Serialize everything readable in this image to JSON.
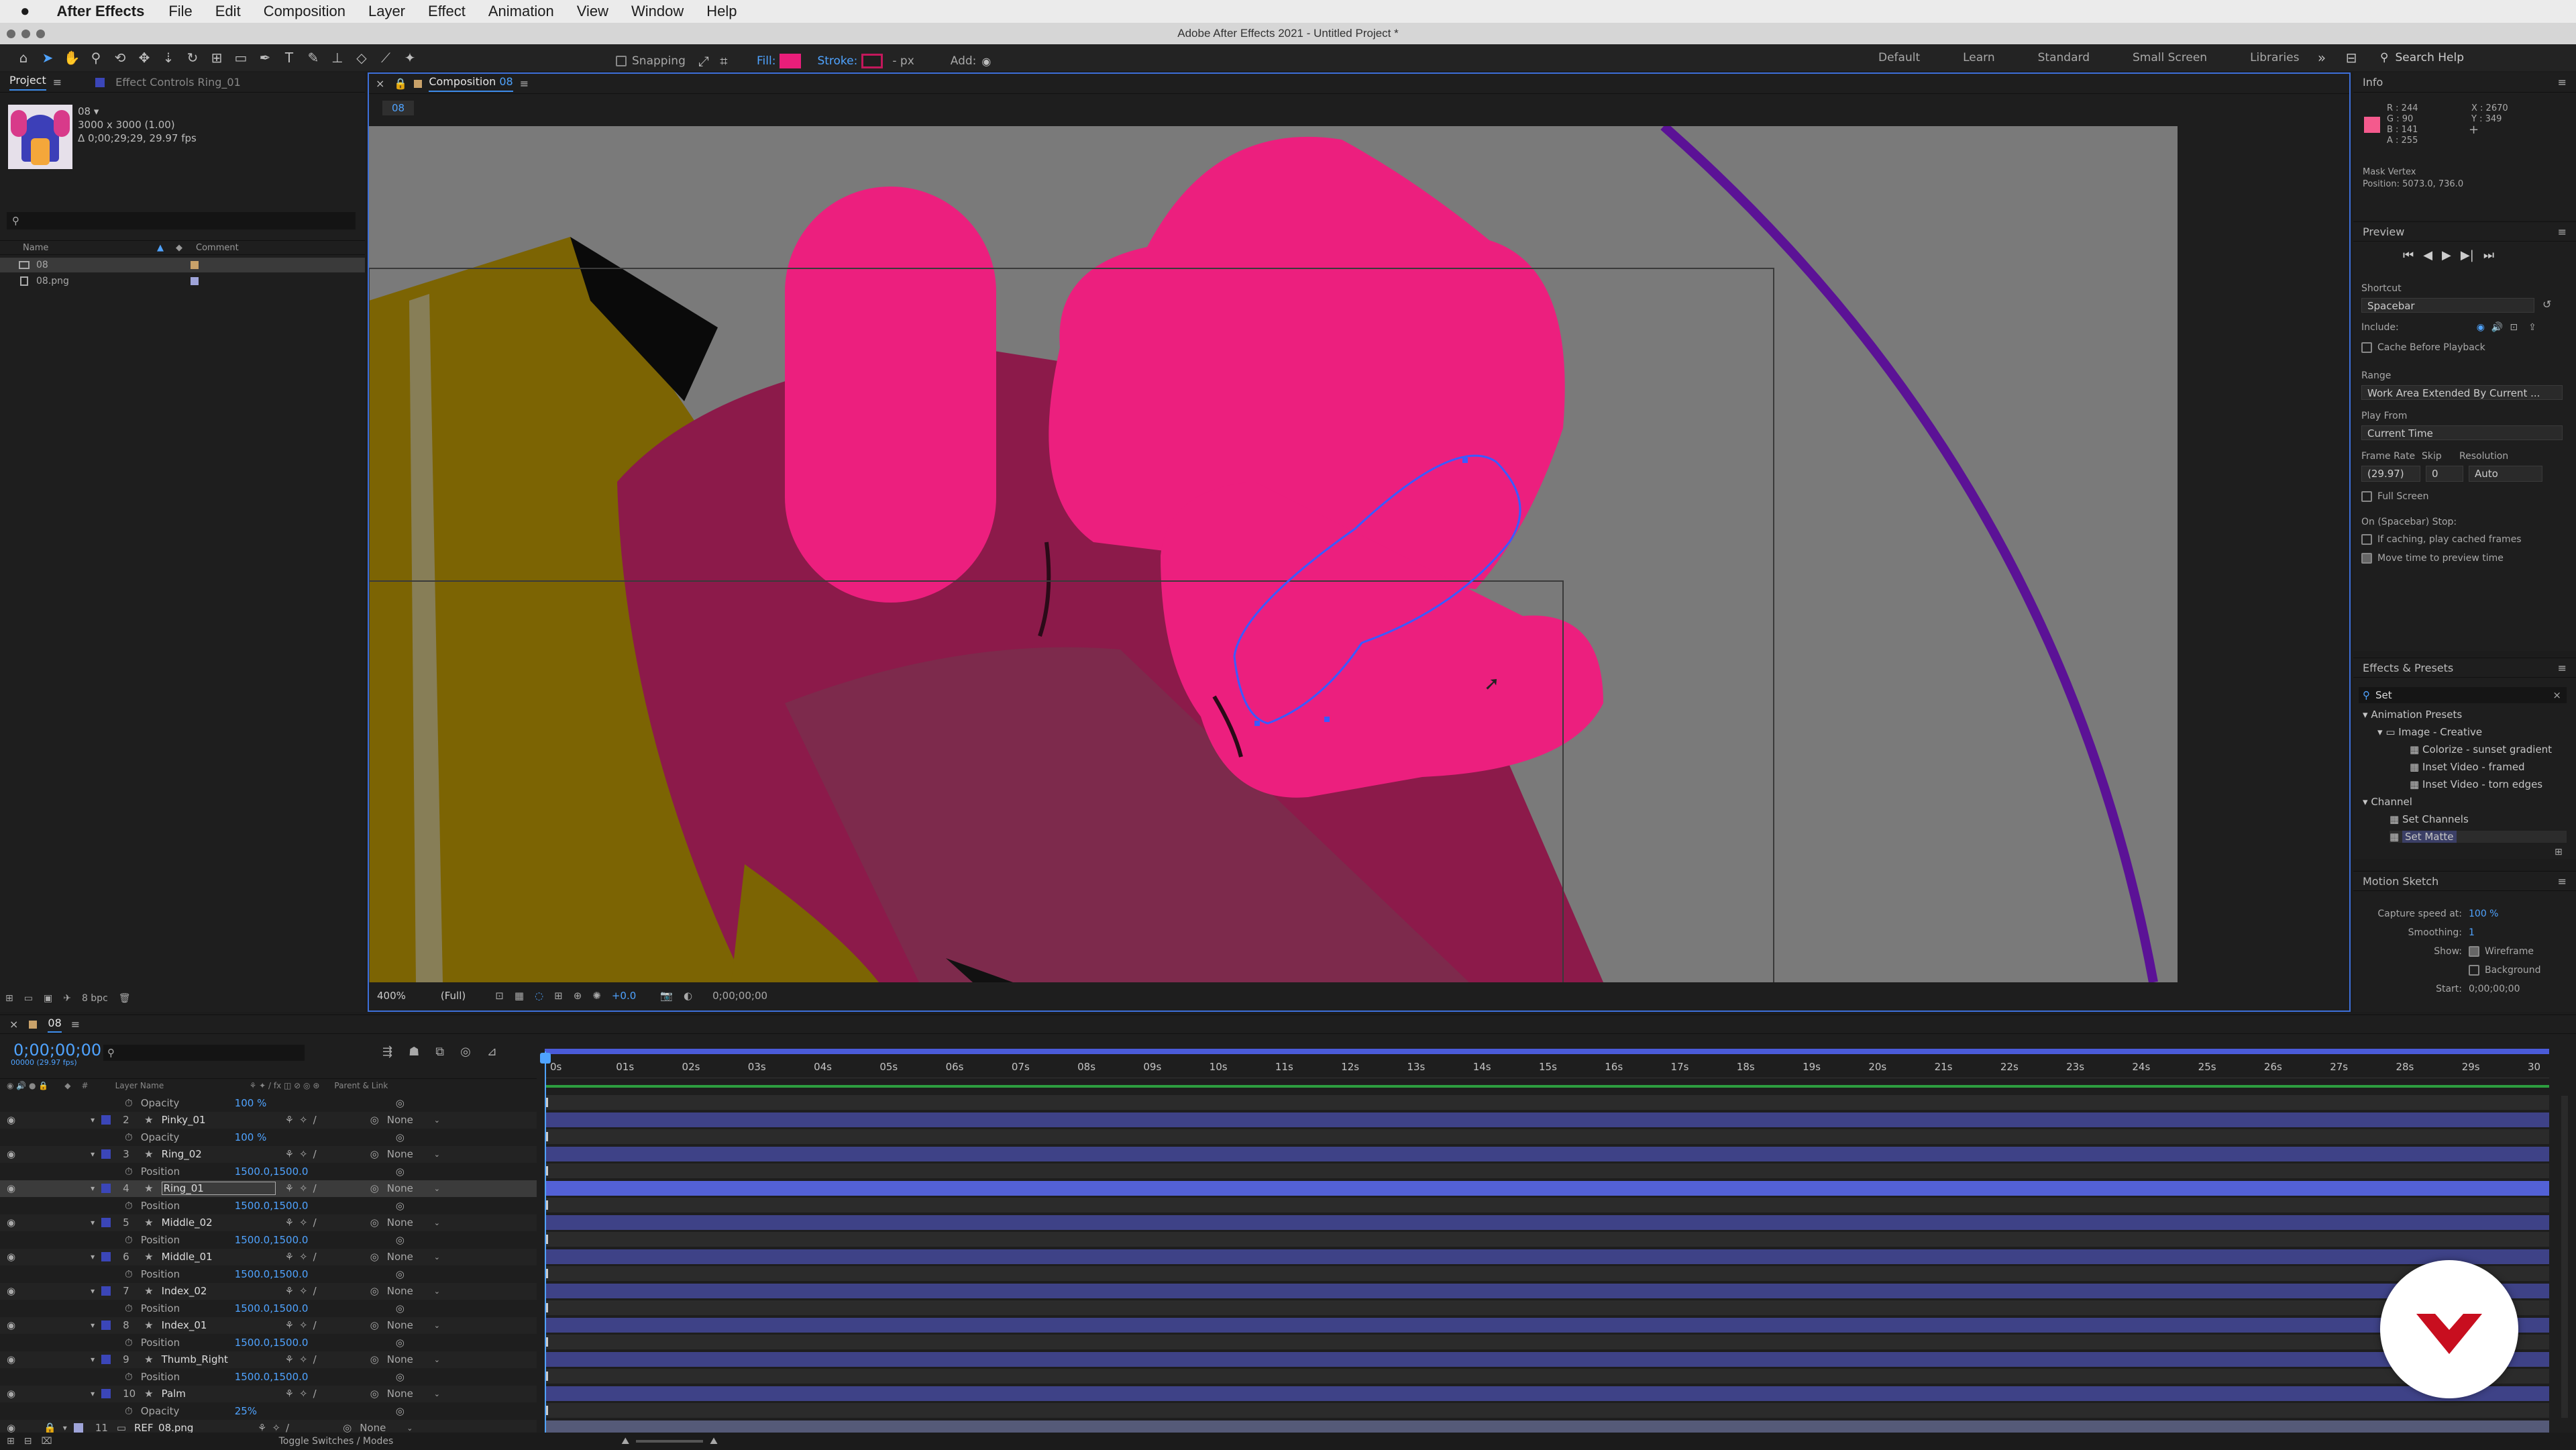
{
  "menubar": {
    "app": "After Effects",
    "items": [
      "File",
      "Edit",
      "Composition",
      "Layer",
      "Effect",
      "Animation",
      "View",
      "Window",
      "Help"
    ]
  },
  "window_title": "Adobe After Effects 2021 - Untitled Project *",
  "toolbar": {
    "snapping": "Snapping",
    "fill": "Fill:",
    "stroke": "Stroke:",
    "stroke_px": "- px",
    "add": "Add:",
    "workspaces": [
      "Default",
      "Learn",
      "Standard",
      "Small Screen",
      "Libraries"
    ],
    "search_placeholder": "Search Help",
    "fill_color": "#e91e7a",
    "stroke_color": "#c2185b"
  },
  "project": {
    "tab": "Project",
    "tab2": "Effect Controls Ring_01",
    "item_name": "08 ▾",
    "item_dims": "3000 x 3000 (1.00)",
    "item_dur": "Δ 0;00;29;29, 29.97 fps",
    "col_name": "Name",
    "col_comment": "Comment",
    "rows": [
      {
        "name": "08",
        "type": "comp"
      },
      {
        "name": "08.png",
        "type": "footage"
      }
    ],
    "bpc": "8 bpc"
  },
  "comp": {
    "tab": "Composition",
    "comp_name": "08",
    "crumb": "08",
    "zoom": "400%",
    "resolution": "(Full)",
    "exposure": "+0.0",
    "timecode": "0;00;00;00"
  },
  "info": {
    "title": "Info",
    "r": "R : 244",
    "g": "G : 90",
    "b": "B : 141",
    "a": "A : 255",
    "x": "X : 2670",
    "y": "Y : 349",
    "sample_color": "#f45a8d",
    "status1": "Mask Vertex",
    "status2": "Position: 5073.0, 736.0"
  },
  "preview": {
    "title": "Preview",
    "shortcut_label": "Shortcut",
    "shortcut": "Spacebar",
    "include": "Include:",
    "cache_before": "Cache Before Playback",
    "range_label": "Range",
    "range": "Work Area Extended By Current ...",
    "play_from_label": "Play From",
    "play_from": "Current Time",
    "frame_rate_label": "Frame Rate",
    "skip_label": "Skip",
    "resolution_label": "Resolution",
    "frame_rate": "(29.97)",
    "skip": "0",
    "resolution": "Auto",
    "full_screen": "Full Screen",
    "on_stop": "On (Spacebar) Stop:",
    "if_caching": "If caching, play cached frames",
    "move_time": "Move time to preview time"
  },
  "effects": {
    "title": "Effects & Presets",
    "search": "Set",
    "items": [
      {
        "label": "Animation Presets",
        "level": 0
      },
      {
        "label": "Image - Creative",
        "level": 1
      },
      {
        "label": "Colorize - sunset gradient",
        "level": 2
      },
      {
        "label": "Inset Video - framed",
        "level": 2
      },
      {
        "label": "Inset Video - torn edges",
        "level": 2
      },
      {
        "label": "Channel",
        "level": 0
      },
      {
        "label": "Set Channels",
        "level": 2
      },
      {
        "label": "Set Matte",
        "level": 2
      }
    ]
  },
  "motion_sketch": {
    "title": "Motion Sketch",
    "capture_label": "Capture speed at:",
    "capture": "100 %",
    "smoothing_label": "Smoothing:",
    "smoothing": "1",
    "show_label": "Show:",
    "wireframe": "Wireframe",
    "background": "Background",
    "start_label": "Start:",
    "start": "0;00;00;00"
  },
  "timeline": {
    "tab": "08",
    "timecode": "0;00;00;00",
    "subtime": "00000 (29.97 fps)",
    "col_layer": "Layer Name",
    "col_parent": "Parent & Link",
    "toggle": "Toggle Switches / Modes",
    "ruler": [
      "0s",
      "01s",
      "02s",
      "03s",
      "04s",
      "05s",
      "06s",
      "07s",
      "08s",
      "09s",
      "10s",
      "11s",
      "12s",
      "13s",
      "14s",
      "15s",
      "16s",
      "17s",
      "18s",
      "19s",
      "20s",
      "21s",
      "22s",
      "23s",
      "24s",
      "25s",
      "26s",
      "27s",
      "28s",
      "29s",
      "30"
    ],
    "rows": [
      {
        "kind": "prop",
        "label": "Opacity",
        "value": "100 %"
      },
      {
        "kind": "layer",
        "num": "2",
        "name": "Pinky_01",
        "parent": "None"
      },
      {
        "kind": "prop",
        "label": "Opacity",
        "value": "100 %"
      },
      {
        "kind": "layer",
        "num": "3",
        "name": "Ring_02",
        "parent": "None"
      },
      {
        "kind": "prop",
        "label": "Position",
        "value": "1500.0,1500.0"
      },
      {
        "kind": "layer",
        "num": "4",
        "name": "Ring_01",
        "parent": "None",
        "selected": true
      },
      {
        "kind": "prop",
        "label": "Position",
        "value": "1500.0,1500.0"
      },
      {
        "kind": "layer",
        "num": "5",
        "name": "Middle_02",
        "parent": "None"
      },
      {
        "kind": "prop",
        "label": "Position",
        "value": "1500.0,1500.0"
      },
      {
        "kind": "layer",
        "num": "6",
        "name": "Middle_01",
        "parent": "None"
      },
      {
        "kind": "prop",
        "label": "Position",
        "value": "1500.0,1500.0"
      },
      {
        "kind": "layer",
        "num": "7",
        "name": "Index_02",
        "parent": "None"
      },
      {
        "kind": "prop",
        "label": "Position",
        "value": "1500.0,1500.0"
      },
      {
        "kind": "layer",
        "num": "8",
        "name": "Index_01",
        "parent": "None"
      },
      {
        "kind": "prop",
        "label": "Position",
        "value": "1500.0,1500.0"
      },
      {
        "kind": "layer",
        "num": "9",
        "name": "Thumb_Right",
        "parent": "None"
      },
      {
        "kind": "prop",
        "label": "Position",
        "value": "1500.0,1500.0"
      },
      {
        "kind": "layer",
        "num": "10",
        "name": "Palm",
        "parent": "None"
      },
      {
        "kind": "prop",
        "label": "Opacity",
        "value": "25%"
      },
      {
        "kind": "layer",
        "num": "11",
        "name": "REF_08.png",
        "parent": "None",
        "footage": true
      }
    ]
  }
}
